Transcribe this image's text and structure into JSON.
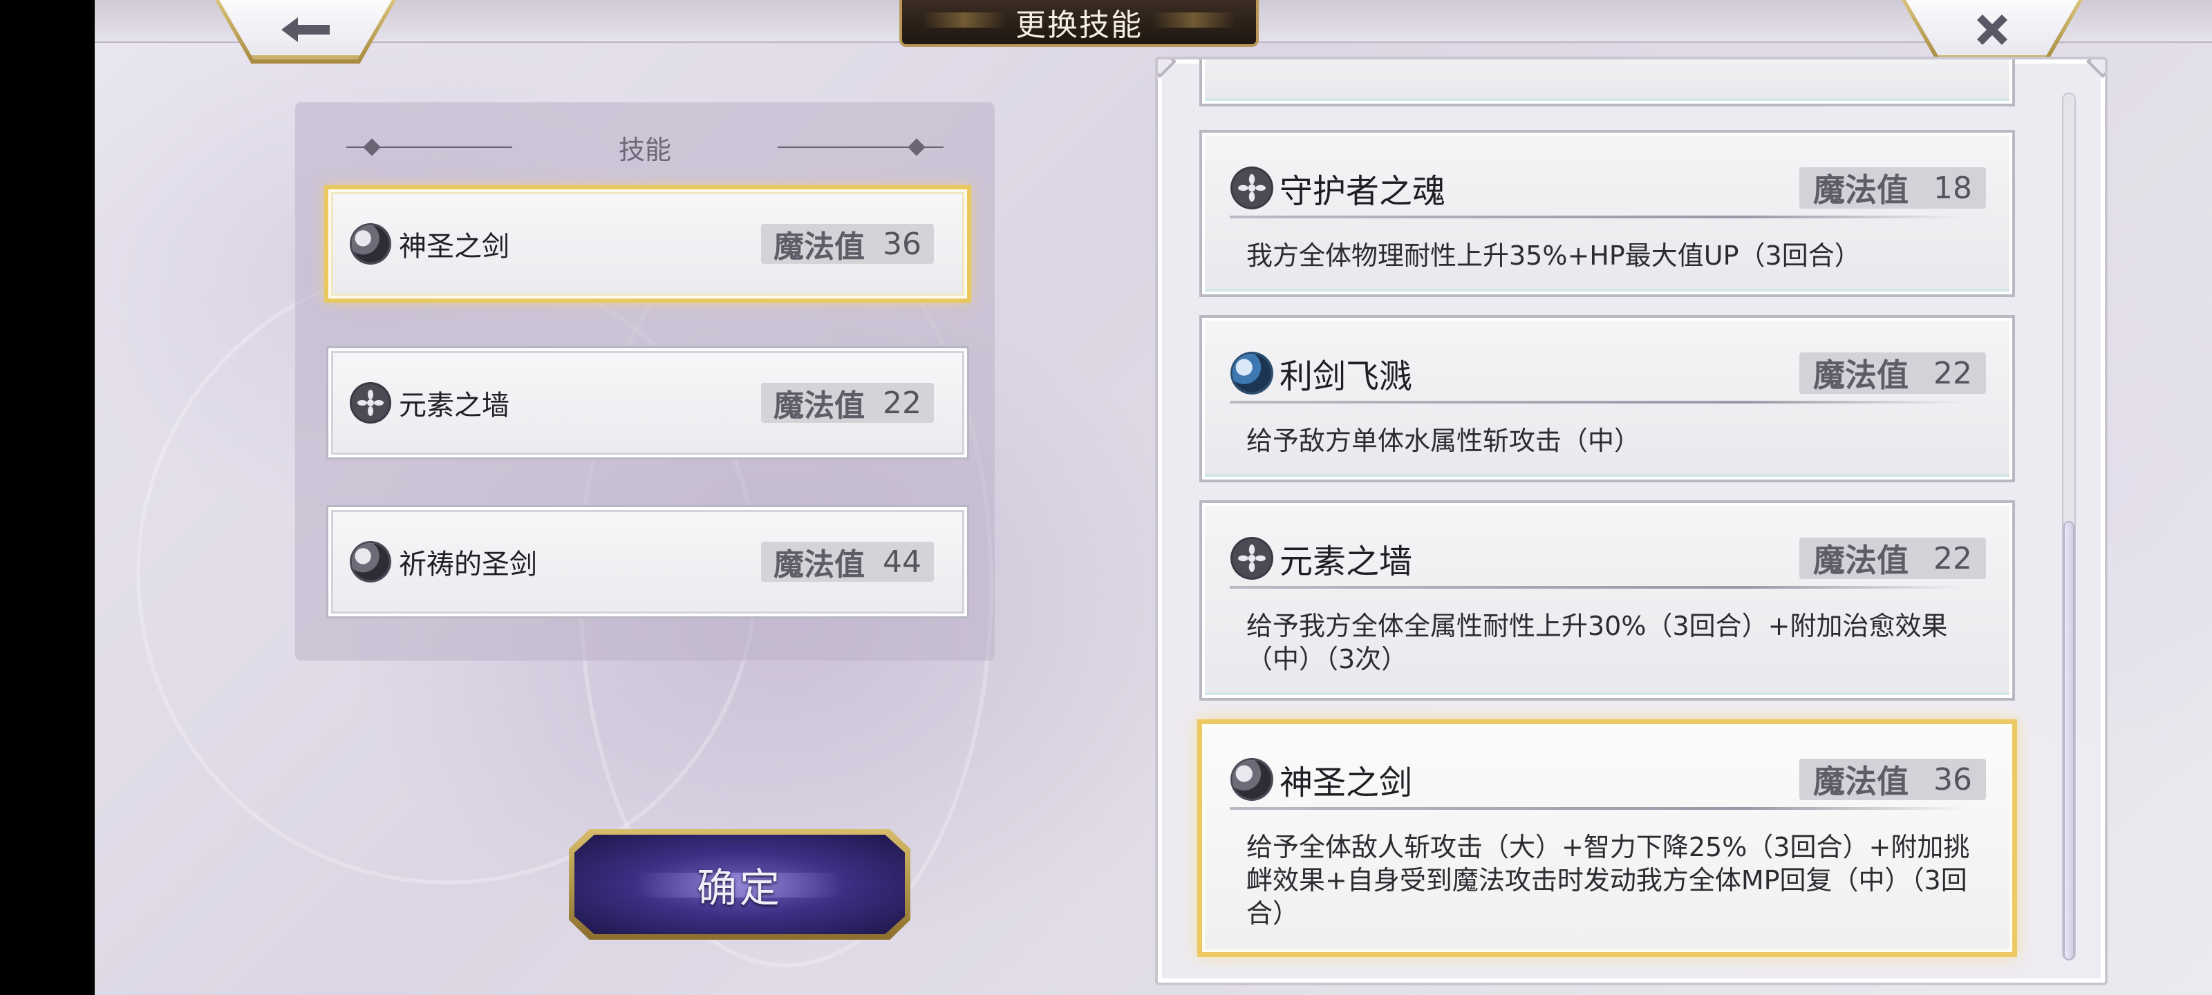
{
  "header": {
    "title": "更换技能"
  },
  "left_panel": {
    "heading": "技能",
    "slots": [
      {
        "name": "神圣之剑",
        "mp_label": "魔法值",
        "mp": "36",
        "icon": "moon-icon",
        "selected": true
      },
      {
        "name": "元素之墙",
        "mp_label": "魔法值",
        "mp": "22",
        "icon": "flower-icon",
        "selected": false
      },
      {
        "name": "祈祷的圣剑",
        "mp_label": "魔法值",
        "mp": "44",
        "icon": "moon-icon",
        "selected": false
      }
    ]
  },
  "confirm_button": {
    "label": "确定"
  },
  "skill_list": {
    "cards": [
      {
        "name": "守护者之魂",
        "mp_label": "魔法值",
        "mp": "18",
        "icon": "flower-icon",
        "desc": "我方全体物理耐性上升35%+HP最大值UP（3回合）"
      },
      {
        "name": "利剑飞溅",
        "mp_label": "魔法值",
        "mp": "22",
        "icon": "blue-moon-icon",
        "desc": "给予敌方单体水属性斩攻击（中）"
      },
      {
        "name": "元素之墙",
        "mp_label": "魔法值",
        "mp": "22",
        "icon": "flower-icon",
        "desc": "给予我方全体全属性耐性上升30%（3回合）+附加治愈效果（中）（3次）"
      },
      {
        "name": "神圣之剑",
        "mp_label": "魔法值",
        "mp": "36",
        "icon": "moon-icon",
        "selected": true,
        "desc": "给予全体敌人斩攻击（大）+智力下降25%（3回合）+附加挑衅效果+自身受到魔法攻击时发动我方全体MP回复（中）（3回合）"
      }
    ]
  },
  "colors": {
    "selected_gold": "#e9c85e",
    "confirm_purple": "#3d2f85",
    "title_plate": "#2a1f18"
  }
}
